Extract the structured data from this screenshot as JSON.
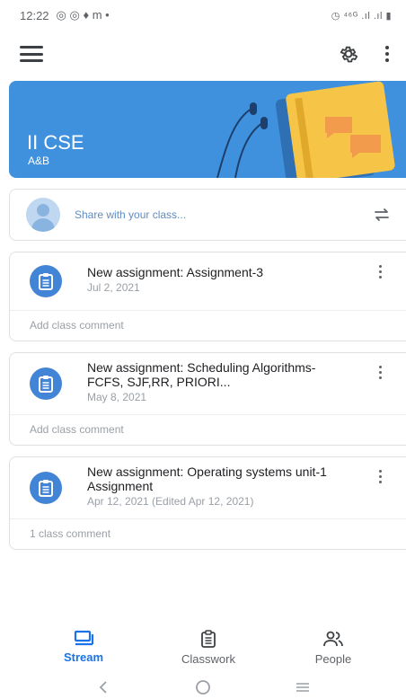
{
  "status_bar": {
    "time": "12:22",
    "left_glyphs": "◎ ◎ ♦ m •",
    "right_glyphs": "◷ ⁴⁶ᴳ .ıl .ıl ▮"
  },
  "banner": {
    "title": "II CSE",
    "subtitle": "A&B",
    "color": "#3f91de"
  },
  "share": {
    "placeholder": "Share with your class..."
  },
  "posts": [
    {
      "title": "New assignment: Assignment-3",
      "date": "Jul 2, 2021",
      "comment": "Add class comment"
    },
    {
      "title": "New assignment: Scheduling Algorithms- FCFS, SJF,RR, PRIORI...",
      "date": "May 8, 2021",
      "comment": "Add class comment"
    },
    {
      "title": "New assignment: Operating systems unit-1 Assignment",
      "date": "Apr 12, 2021 (Edited Apr 12, 2021)",
      "comment": "1 class comment"
    }
  ],
  "bottom_nav": {
    "items": [
      {
        "label": "Stream",
        "icon": "stream-icon",
        "active": true
      },
      {
        "label": "Classwork",
        "icon": "classwork-icon",
        "active": false
      },
      {
        "label": "People",
        "icon": "people-icon",
        "active": false
      }
    ]
  },
  "colors": {
    "accent": "#1a73e8",
    "assignment_icon": "#4285d6"
  }
}
